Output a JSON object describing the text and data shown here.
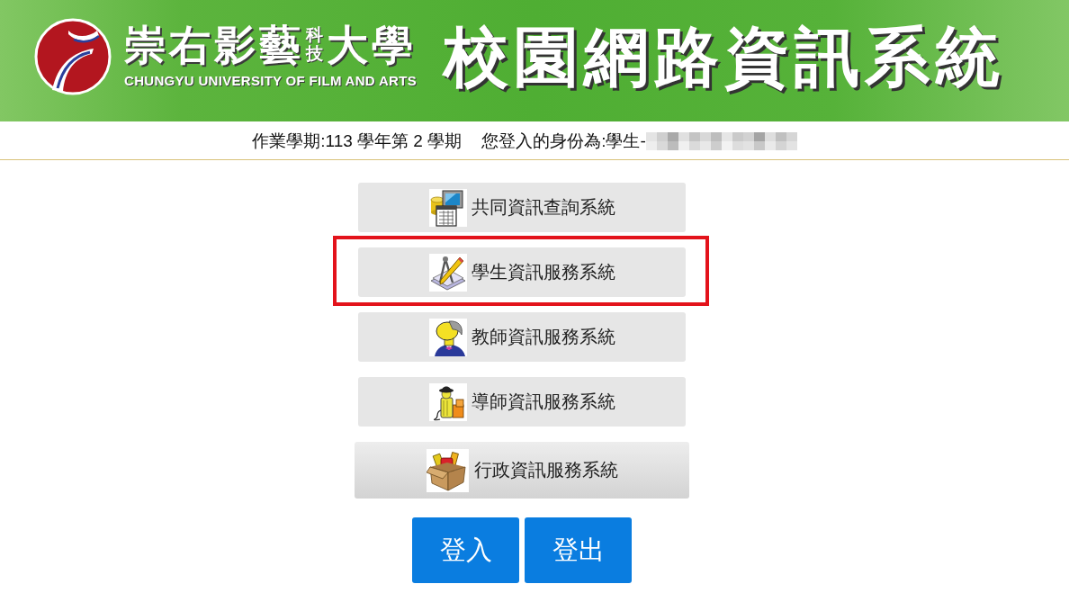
{
  "header": {
    "school_name": {
      "part_1": "崇右影藝",
      "stacked": "科技",
      "part_2": "大學"
    },
    "school_name_english": "CHUNGYU UNIVERSITY OF FILM AND ARTS",
    "title": "校園網路資訊系統"
  },
  "session": {
    "term": "作業學期:113 學年第 2 學期",
    "identity": "您登入的身份為:學生-"
  },
  "systems": [
    {
      "label": "共同資訊查詢系統",
      "kind": "flat",
      "highlighted": false
    },
    {
      "label": "學生資訊服務系統",
      "kind": "flat",
      "highlighted": true
    },
    {
      "label": "教師資訊服務系統",
      "kind": "flat",
      "highlighted": false
    },
    {
      "label": "導師資訊服務系統",
      "kind": "flat",
      "highlighted": false
    },
    {
      "label": "行政資訊服務系統",
      "kind": "raised",
      "highlighted": false
    }
  ],
  "actions": [
    "登入",
    "登出"
  ]
}
